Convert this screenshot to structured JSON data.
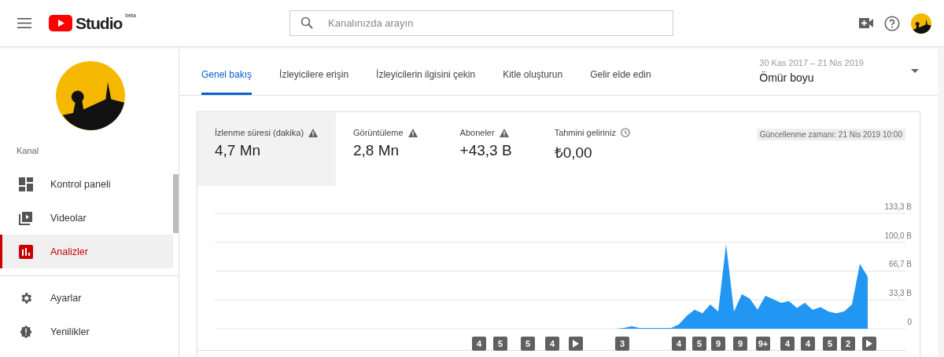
{
  "header": {
    "logo_text": "Studio",
    "logo_badge": "beta",
    "search": {
      "placeholder": "Kanalınızda arayın"
    }
  },
  "sidebar": {
    "section_label": "Kanal",
    "items": [
      {
        "label": "Kontrol paneli",
        "selected": false
      },
      {
        "label": "Videolar",
        "selected": false
      },
      {
        "label": "Analizler",
        "selected": true
      }
    ],
    "bottom_items": [
      {
        "label": "Ayarlar"
      },
      {
        "label": "Yenilikler"
      }
    ]
  },
  "tabs": [
    {
      "label": "Genel bakış",
      "selected": true
    },
    {
      "label": "İzleyicilere erişin",
      "selected": false
    },
    {
      "label": "İzleyicilerin ilgisini çekin",
      "selected": false
    },
    {
      "label": "Kitle oluşturun",
      "selected": false
    },
    {
      "label": "Gelir elde edin",
      "selected": false
    }
  ],
  "date_range": {
    "range": "30 Kas 2017 – 21 Nis 2019",
    "period": "Ömür boyu"
  },
  "metrics": [
    {
      "label": "İzlenme süresi (dakika)",
      "value": "4,7 Mn",
      "kind": "warning",
      "selected": true
    },
    {
      "label": "Görüntüleme",
      "value": "2,8 Mn",
      "kind": "warning",
      "selected": false
    },
    {
      "label": "Aboneler",
      "value": "+43,3 B",
      "kind": "warning",
      "selected": false
    },
    {
      "label": "Tahmini geliriniz",
      "value": "₺0,00",
      "kind": "clock",
      "selected": false
    }
  ],
  "updated": "Güncellenme zamanı: 21 Nis 2019 10:00",
  "chart_data": {
    "type": "area",
    "grid": true,
    "ylim": [
      0,
      133.3
    ],
    "yticks": [
      {
        "value": 0,
        "label": "0"
      },
      {
        "value": 33.3,
        "label": "33,3 B"
      },
      {
        "value": 66.7,
        "label": "66,7 B"
      },
      {
        "value": 100,
        "label": "100,0 B"
      },
      {
        "value": 133.3,
        "label": "133,3 B"
      }
    ],
    "series": [
      {
        "color": "#2196f3",
        "values": [
          0,
          0,
          0,
          0,
          0,
          0,
          0,
          0,
          0,
          0,
          0,
          0,
          0,
          0,
          0,
          0,
          0,
          0,
          0,
          0,
          0,
          0,
          0,
          0,
          0,
          0,
          0,
          0,
          0,
          0,
          0,
          0,
          0,
          0,
          0,
          0,
          0,
          0,
          0,
          0,
          0,
          0,
          0,
          0,
          0,
          0,
          0,
          0,
          0,
          0,
          0,
          0,
          1,
          3,
          1,
          1,
          1,
          1,
          1,
          5,
          15,
          22,
          18,
          28,
          20,
          98,
          20,
          40,
          35,
          22,
          38,
          34,
          30,
          32,
          24,
          30,
          22,
          25,
          20,
          18,
          20,
          28,
          75,
          60
        ]
      }
    ]
  },
  "markers": [
    {
      "kind": "count",
      "label": "4"
    },
    {
      "kind": "count",
      "label": "5"
    },
    {
      "kind": "count",
      "label": "5"
    },
    {
      "kind": "count",
      "label": "4"
    },
    {
      "kind": "play"
    },
    {
      "kind": "count",
      "label": "3"
    },
    {
      "kind": "count",
      "label": "4"
    },
    {
      "kind": "count",
      "label": "5"
    },
    {
      "kind": "count",
      "label": "9"
    },
    {
      "kind": "count",
      "label": "9"
    },
    {
      "kind": "count",
      "label": "9+"
    },
    {
      "kind": "count",
      "label": "4"
    },
    {
      "kind": "count",
      "label": "4"
    },
    {
      "kind": "count",
      "label": "5"
    },
    {
      "kind": "count",
      "label": "2"
    },
    {
      "kind": "play"
    }
  ]
}
